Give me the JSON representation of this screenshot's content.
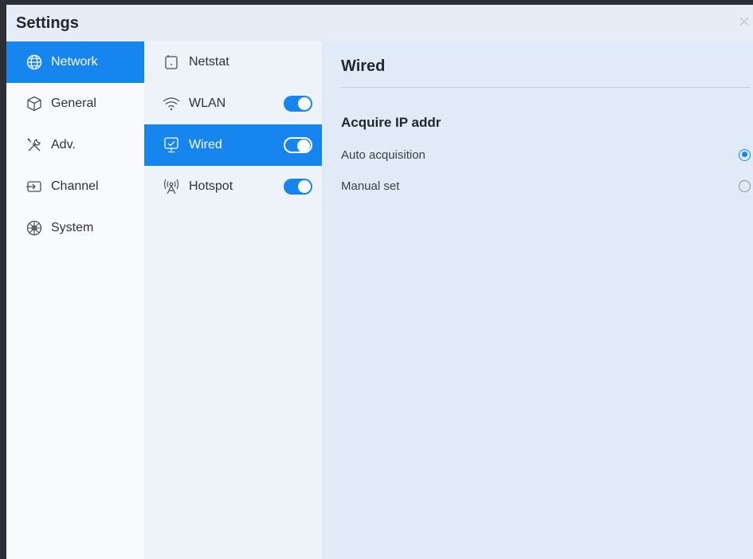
{
  "window": {
    "title": "Settings"
  },
  "colors": {
    "accent": "#1785ee",
    "left_bg": "#f8fafd",
    "mid_bg": "#eef3fa",
    "right_bg": "#e1eaf7"
  },
  "sidebar": {
    "items": [
      {
        "label": "Network",
        "icon": "globe-icon",
        "active": true
      },
      {
        "label": "General",
        "icon": "cube-icon",
        "active": false
      },
      {
        "label": "Adv.",
        "icon": "tools-icon",
        "active": false
      },
      {
        "label": "Channel",
        "icon": "input-icon",
        "active": false
      },
      {
        "label": "System",
        "icon": "system-icon",
        "active": false
      }
    ]
  },
  "network_menu": {
    "items": [
      {
        "label": "Netstat",
        "icon": "netstat-icon",
        "toggle": null,
        "active": false
      },
      {
        "label": "WLAN",
        "icon": "wifi-icon",
        "toggle": "on",
        "active": false
      },
      {
        "label": "Wired",
        "icon": "ethernet-icon",
        "toggle": "on",
        "active": true
      },
      {
        "label": "Hotspot",
        "icon": "hotspot-icon",
        "toggle": "on",
        "active": false
      }
    ]
  },
  "panel": {
    "title": "Wired",
    "section_heading": "Acquire IP addr",
    "options": [
      {
        "label": "Auto acquisition",
        "selected": true
      },
      {
        "label": "Manual set",
        "selected": false
      }
    ]
  }
}
